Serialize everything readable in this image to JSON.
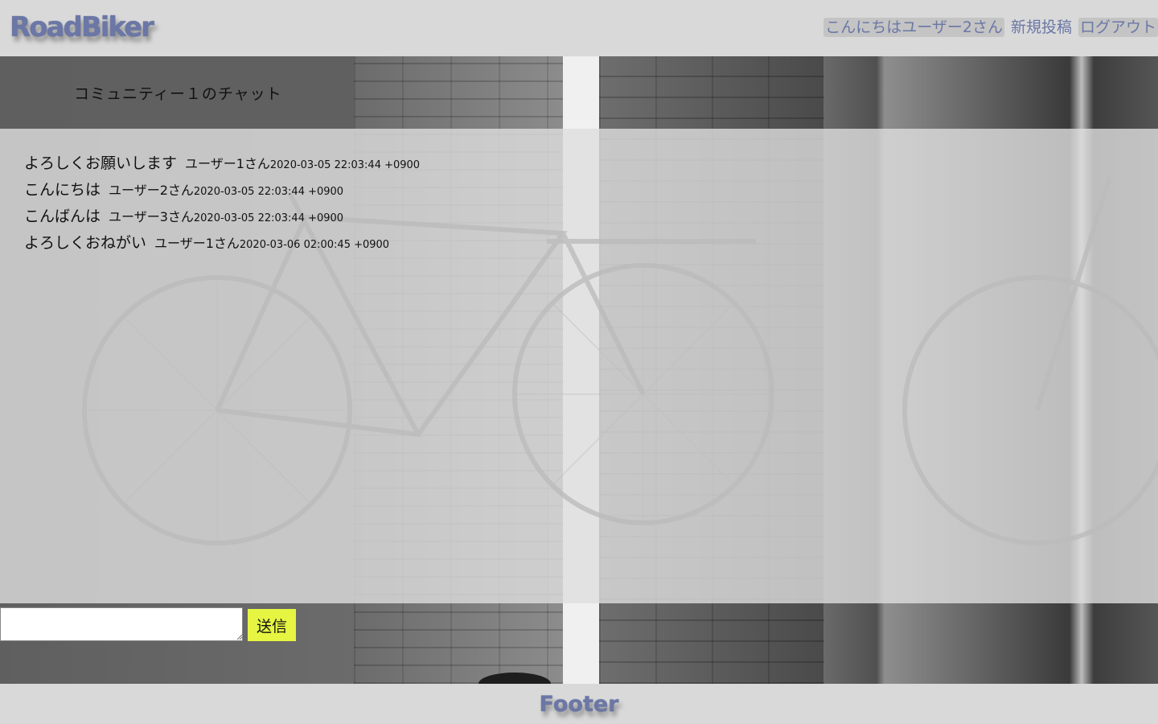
{
  "header": {
    "logo": "RoadBiker",
    "greeting": "こんにちはユーザー2さん",
    "new_post": "新規投稿",
    "logout": "ログアウト"
  },
  "chat": {
    "title": "コミュニティー１のチャット",
    "messages": [
      {
        "text": "よろしくお願いします",
        "user": "ユーザー1さん",
        "time": "2020-03-05 22:03:44 +0900"
      },
      {
        "text": "こんにちは",
        "user": "ユーザー2さん",
        "time": "2020-03-05 22:03:44 +0900"
      },
      {
        "text": "こんばんは",
        "user": "ユーザー3さん",
        "time": "2020-03-05 22:03:44 +0900"
      },
      {
        "text": "よろしくおねがい",
        "user": "ユーザー1さん",
        "time": "2020-03-06 02:00:45 +0900"
      }
    ]
  },
  "form": {
    "input_value": "",
    "send_label": "送信"
  },
  "footer": {
    "text": "Footer"
  },
  "colors": {
    "accent": "#6b77a6",
    "send_button": "#e6f542",
    "header_bg": "#d9d9d9"
  }
}
